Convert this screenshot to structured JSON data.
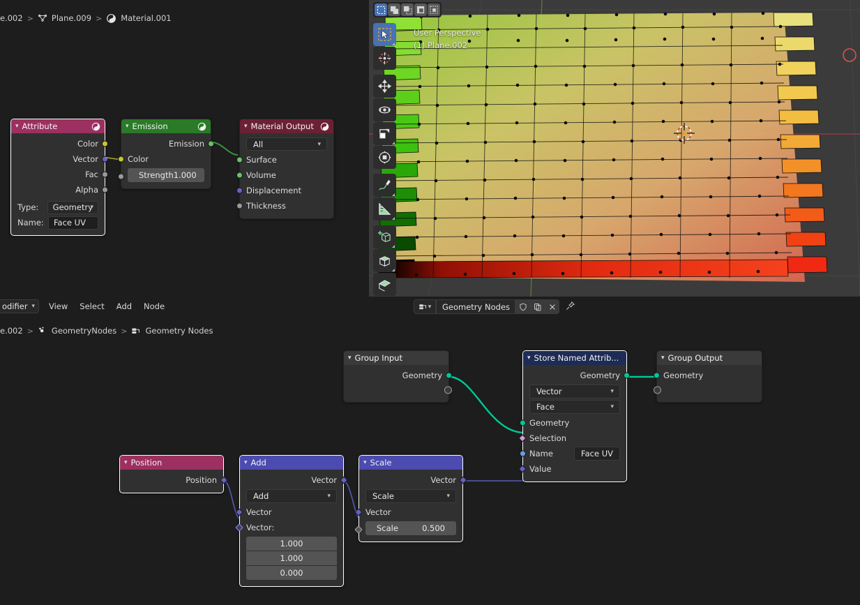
{
  "app": "Blender",
  "shader_editor": {
    "breadcrumb": [
      {
        "label": "e.002",
        "icon": "scene-icon"
      },
      {
        "label": "Plane.009",
        "icon": "mesh-data-icon"
      },
      {
        "label": "Material.001",
        "icon": "material-icon"
      }
    ],
    "nodes": [
      {
        "id": "attribute",
        "title": "Attribute",
        "header_color": "#9c3060",
        "selected": true,
        "icon": "material-sphere-icon",
        "outputs": [
          {
            "label": "Color",
            "color": "#c7c729"
          },
          {
            "label": "Vector",
            "color": "#6363c7"
          },
          {
            "label": "Fac",
            "color": "#9a9a9a"
          },
          {
            "label": "Alpha",
            "color": "#9a9a9a"
          }
        ],
        "properties": [
          {
            "label": "Type:",
            "value": "Geometry",
            "widget": "dropdown"
          },
          {
            "label": "Name:",
            "value": "Face UV",
            "widget": "text"
          }
        ]
      },
      {
        "id": "emission",
        "title": "Emission",
        "header_color": "#2a7a27",
        "icon": "material-sphere-icon",
        "outputs": [
          {
            "label": "Emission",
            "color": "#69c269"
          }
        ],
        "inputs": [
          {
            "label": "Color",
            "color": "#c7c729"
          },
          {
            "label": "Strength",
            "value": "1.000",
            "color": "#9a9a9a",
            "widget": "value"
          }
        ]
      },
      {
        "id": "material-output",
        "title": "Material Output",
        "header_color": "#6b2036",
        "icon": "material-sphere-icon",
        "dropdown": "All",
        "inputs": [
          {
            "label": "Surface",
            "color": "#69c269"
          },
          {
            "label": "Volume",
            "color": "#69c269"
          },
          {
            "label": "Displacement",
            "color": "#6363c7"
          },
          {
            "label": "Thickness",
            "color": "#9a9a9a"
          }
        ]
      }
    ]
  },
  "viewport": {
    "select_modes": [
      "set",
      "extend",
      "subtract",
      "invert",
      "intersect"
    ],
    "active_select_mode": "set",
    "overlay_line1": "User Perspective",
    "overlay_line2": "(1) Plane.002",
    "tools": [
      {
        "name": "tweak-select-box-tool",
        "active": true
      },
      {
        "name": "cursor-tool",
        "active": false
      },
      {
        "name": "move-tool",
        "active": false
      },
      {
        "name": "rotate-tool",
        "active": false
      },
      {
        "name": "scale-tool",
        "active": false
      },
      {
        "name": "transform-tool",
        "active": false
      },
      {
        "name": "annotate-tool",
        "active": false
      },
      {
        "name": "measure-tool",
        "active": false
      },
      {
        "name": "add-cube-tool",
        "active": false
      },
      {
        "name": "extrude-region-tool",
        "active": false
      },
      {
        "name": "inset-faces-tool",
        "active": false
      }
    ]
  },
  "geo_editor": {
    "editor_type": "Modifier",
    "editor_type_label": "odifier",
    "menus": [
      "View",
      "Select",
      "Add",
      "Node"
    ],
    "node_group_name": "Geometry Nodes",
    "header_buttons": [
      "fake-user-shield-icon",
      "new-copy-icon",
      "unlink-x-icon",
      "pin-icon"
    ],
    "breadcrumb": [
      {
        "label": "e.002",
        "icon": "object-icon"
      },
      {
        "label": "GeometryNodes",
        "icon": "modifier-icon"
      },
      {
        "label": "Geometry Nodes",
        "icon": "nodetree-icon"
      }
    ],
    "nodes": [
      {
        "id": "group-input",
        "title": "Group Input",
        "header_color": "#3a3a3a",
        "outputs": [
          {
            "label": "Geometry",
            "color": "#00c795"
          },
          {
            "label": "",
            "color": "hollow"
          }
        ]
      },
      {
        "id": "store-named-attribute",
        "title": "Store Named Attrib...",
        "header_color": "#1d2b55",
        "selected": true,
        "outputs": [
          {
            "label": "Geometry",
            "color": "#00c795"
          }
        ],
        "dropdowns": [
          "Vector",
          "Face"
        ],
        "inputs": [
          {
            "label": "Geometry",
            "color": "#00c795",
            "shape": "circle"
          },
          {
            "label": "Selection",
            "color": "#d59bd5",
            "shape": "diamond"
          },
          {
            "label": "Name",
            "color": "#63a0e8",
            "shape": "circle",
            "value": "Face UV"
          },
          {
            "label": "Value",
            "color": "#6363c7",
            "shape": "diamond"
          }
        ]
      },
      {
        "id": "group-output",
        "title": "Group Output",
        "header_color": "#3a3a3a",
        "inputs": [
          {
            "label": "Geometry",
            "color": "#00c795"
          },
          {
            "label": "",
            "color": "hollow"
          }
        ]
      },
      {
        "id": "position",
        "title": "Position",
        "header_color": "#9c3060",
        "selected": true,
        "outputs": [
          {
            "label": "Position",
            "color": "#6363c7",
            "shape": "diamond"
          }
        ]
      },
      {
        "id": "vector-math-add",
        "title": "Add",
        "header_color": "#4b4bb0",
        "selected": true,
        "operation": "Add",
        "outputs": [
          {
            "label": "Vector",
            "color": "#6363c7",
            "shape": "diamond"
          }
        ],
        "inputs": [
          {
            "label": "Vector",
            "color": "#6363c7",
            "shape": "diamond"
          },
          {
            "label": "Vector:",
            "color": "#6363c7",
            "shape": "diamond-hollow"
          }
        ],
        "vector_values": [
          "1.000",
          "1.000",
          "0.000"
        ]
      },
      {
        "id": "vector-math-scale",
        "title": "Scale",
        "header_color": "#4b4bb0",
        "selected": true,
        "operation": "Scale",
        "outputs": [
          {
            "label": "Vector",
            "color": "#6363c7",
            "shape": "diamond"
          }
        ],
        "inputs": [
          {
            "label": "Vector",
            "color": "#6363c7",
            "shape": "diamond"
          },
          {
            "label": "Scale",
            "value": "0.500",
            "color": "#9a9a9a",
            "shape": "diamond-hollow",
            "widget": "value"
          }
        ]
      }
    ]
  }
}
